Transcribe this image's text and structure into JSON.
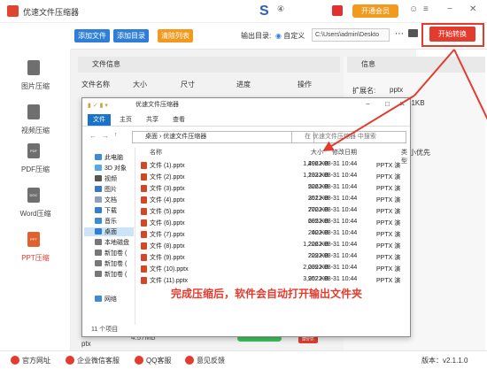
{
  "app": {
    "title": "优速文件压缩器",
    "vip": "开通会员",
    "mid_icon": "④"
  },
  "toolbar": {
    "add_file": "添加文件",
    "add_dir": "添加目录",
    "clear_list": "清除列表",
    "output_label": "输出目录:",
    "custom": "自定义",
    "output_path": "C:\\Users\\admin\\Deskto",
    "start": "开始转换"
  },
  "sidebar": {
    "items": [
      {
        "label": "图片压缩",
        "icon": "image-compress-icon",
        "badge": ""
      },
      {
        "label": "视频压缩",
        "icon": "video-compress-icon",
        "badge": ""
      },
      {
        "label": "PDF压缩",
        "icon": "pdf-compress-icon",
        "badge": "PDF"
      },
      {
        "label": "Word压缩",
        "icon": "word-compress-icon",
        "badge": "DOC"
      },
      {
        "label": "PPT压缩",
        "icon": "ppt-compress-icon",
        "badge": "PPT"
      }
    ]
  },
  "main": {
    "section_title": "文件信息",
    "columns": [
      "文件名称",
      "大小",
      "尺寸",
      "进度",
      "操作"
    ],
    "row_name": "ptx",
    "row_size": "4.57MB",
    "row_delete": "删除"
  },
  "info": {
    "section_title": "信息",
    "ext_label": "扩展名:",
    "ext_value": "pptx",
    "size_value": "31KB",
    "priority": "小优先"
  },
  "explorer": {
    "title": "优速文件压缩器",
    "tabs": [
      "文件",
      "主页",
      "共享",
      "查看"
    ],
    "path": [
      "桌面",
      "优速文件压缩器"
    ],
    "search_placeholder": "在 优速文件压缩器 中搜索",
    "nav": [
      "此电脑",
      "3D 对象",
      "视频",
      "图片",
      "文档",
      "下载",
      "音乐",
      "桌面",
      "本地磁盘",
      "新加卷 (",
      "新加卷 (",
      "新加卷 (",
      "网络"
    ],
    "headers": {
      "name": "名称",
      "size": "大小",
      "date": "修改日期",
      "type": "类型"
    },
    "files": [
      {
        "name": "文件 (1).pptx",
        "size": "1,496 KB",
        "date": "2022-08-31 10:44",
        "type": "PPTX 演"
      },
      {
        "name": "文件 (2).pptx",
        "size": "1,133 KB",
        "date": "2022-08-31 10:44",
        "type": "PPTX 演"
      },
      {
        "name": "文件 (3).pptx",
        "size": "526 KB",
        "date": "2022-08-31 10:44",
        "type": "PPTX 演"
      },
      {
        "name": "文件 (4).pptx",
        "size": "351 KB",
        "date": "2022-08-31 10:44",
        "type": "PPTX 演"
      },
      {
        "name": "文件 (5).pptx",
        "size": "770 KB",
        "date": "2022-08-31 10:44",
        "type": "PPTX 演"
      },
      {
        "name": "文件 (6).pptx",
        "size": "685 KB",
        "date": "2022-08-31 10:44",
        "type": "PPTX 演"
      },
      {
        "name": "文件 (7).pptx",
        "size": "40 KB",
        "date": "2022-08-31 10:44",
        "type": "PPTX 演"
      },
      {
        "name": "文件 (8).pptx",
        "size": "1,226 KB",
        "date": "2022-08-31 10:44",
        "type": "PPTX 演"
      },
      {
        "name": "文件 (9).pptx",
        "size": "229 KB",
        "date": "2022-08-31 10:44",
        "type": "PPTX 演"
      },
      {
        "name": "文件 (10).pptx",
        "size": "2,039 KB",
        "date": "2022-08-31 10:44",
        "type": "PPTX 演"
      },
      {
        "name": "文件 (11).pptx",
        "size": "3,952 KB",
        "date": "2022-08-31 10:44",
        "type": "PPTX 演"
      }
    ],
    "item_count": "11 个项目"
  },
  "annotation": "完成压缩后，软件会自动打开输出文件夹",
  "bottom": {
    "site": "官方网址",
    "wechat": "企业微信客服",
    "qq": "QQ客服",
    "feedback": "意见反馈",
    "version": "版本：v2.1.1.0"
  },
  "colors": {
    "accent": "#e33b2e",
    "blue": "#2f7fd8",
    "orange": "#f29a1e"
  }
}
